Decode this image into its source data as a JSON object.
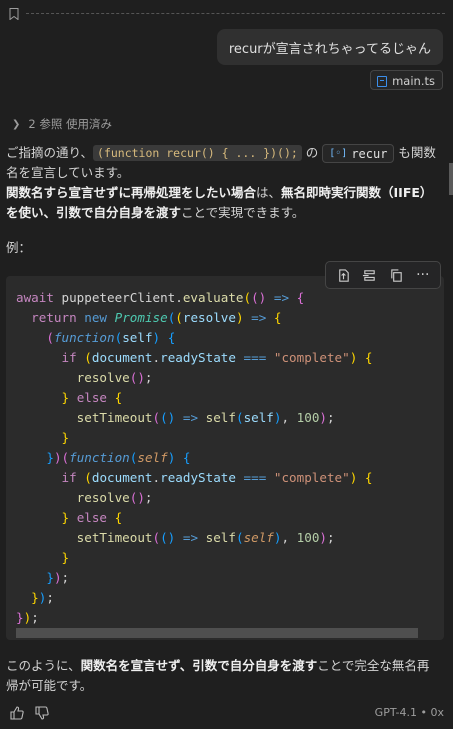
{
  "user_message": "recurが宣言されちゃってるじゃん",
  "attachment": {
    "file_name": "main.ts"
  },
  "references": {
    "label": "2 参照 使用済み"
  },
  "response": {
    "p1_a": "ご指摘の通り、",
    "p1_code": "(function recur() { ... })();",
    "p1_b": " の ",
    "p1_symbol": "recur",
    "p1_c": " も関数名を宣言しています。",
    "p2_bold1": "関数名すら宣言せずに再帰処理をしたい場合",
    "p2_a": "は、",
    "p2_bold2": "無名即時実行関数（IIFE）を使い、引数で自分自身を渡す",
    "p2_b": "ことで実現できます。",
    "example_label": "例：",
    "closing_a": "このように、",
    "closing_bold": "関数名を宣言せず、引数で自分自身を渡す",
    "closing_b": "ことで完全な無名再帰が可能です。"
  },
  "code": {
    "language": "typescript",
    "tokens": {
      "await": "await",
      "client_call": " puppeteerClient.",
      "evaluate": "evaluate",
      "arrow": "=>",
      "return": "return",
      "new": "new",
      "Promise": "Promise",
      "resolve": "resolve",
      "function": "function",
      "self": "self",
      "if": "if",
      "document": "document",
      "readyState": "readyState",
      "eq": "===",
      "complete": "\"complete\"",
      "else": "else",
      "setTimeout": "setTimeout",
      "num100": "100"
    }
  },
  "toolbar": {
    "apply_icon": "apply-in-editor-icon",
    "insert_icon": "insert-at-cursor-icon",
    "copy_icon": "copy-icon",
    "more_icon": "more-icon"
  },
  "footer": {
    "model_label": "GPT-4.1 • 0x"
  },
  "colors": {
    "background": "#1f1f1f",
    "code_background": "#2b2b2b",
    "accent": "#3b8eea"
  }
}
